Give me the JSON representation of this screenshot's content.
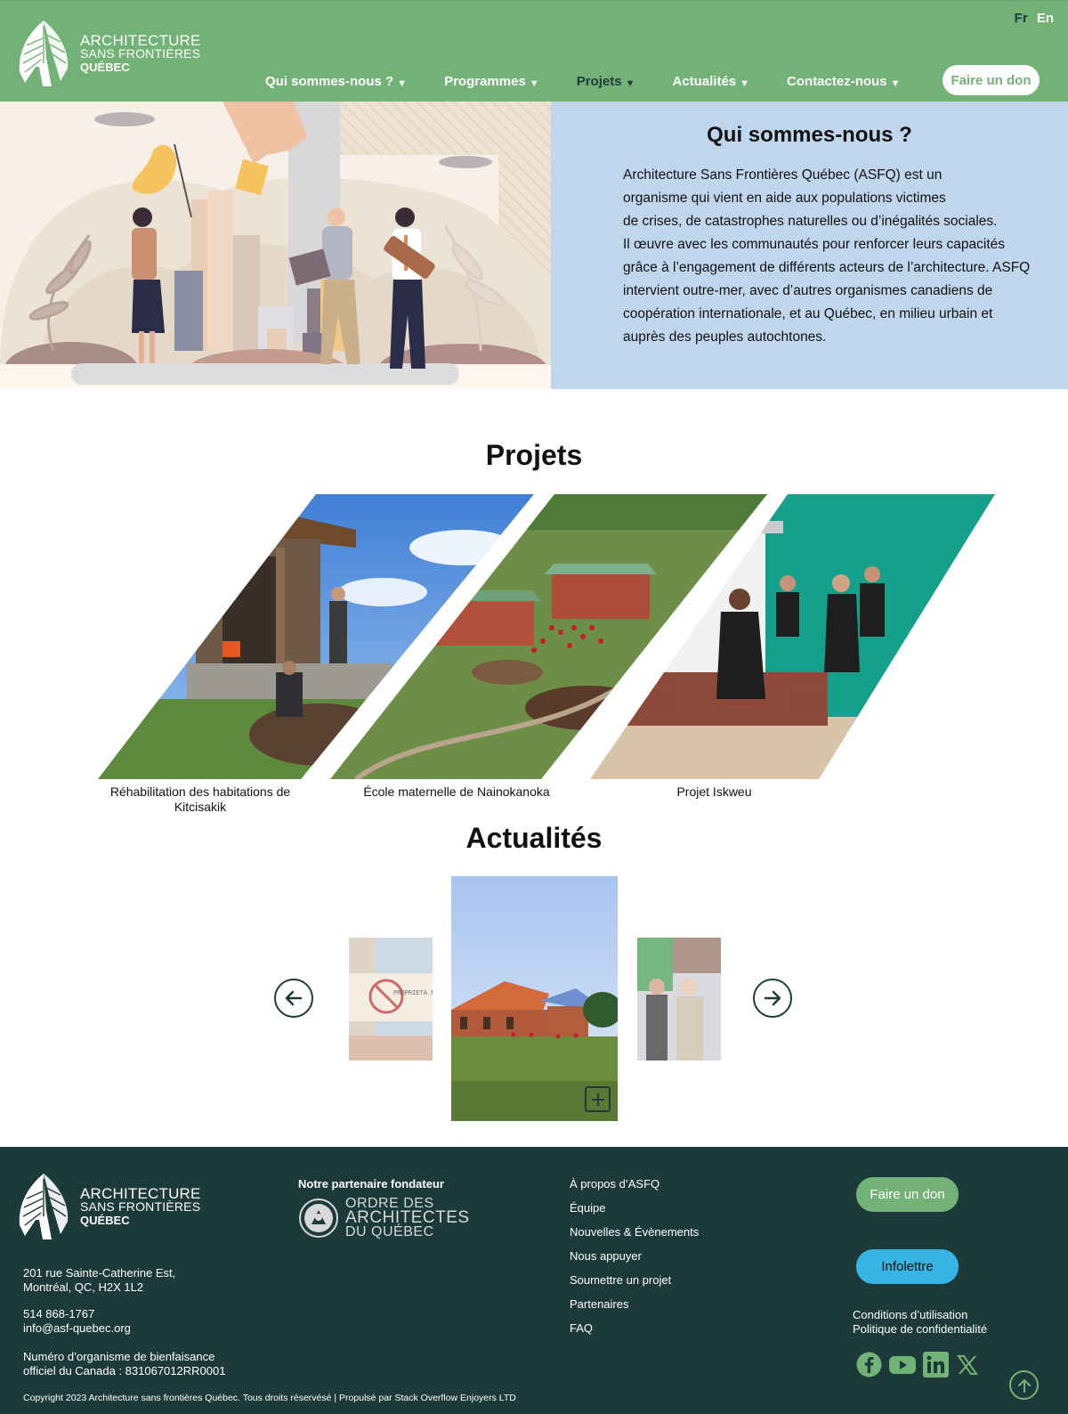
{
  "brand": {
    "line1": "ARCHITECTURE",
    "line2": "SANS FRONTIÈRES",
    "line3": "QUÉBEC",
    "green": "#72b276",
    "dark": "#1c3a39"
  },
  "lang": {
    "fr": "Fr",
    "en": "En",
    "active": "Fr"
  },
  "nav": {
    "items": [
      {
        "label": "Qui sommes-nous ?",
        "caret": "▼"
      },
      {
        "label": "Programmes",
        "caret": "▼"
      },
      {
        "label": "Projets",
        "caret": "▼",
        "active": true
      },
      {
        "label": "Actualités",
        "caret": "▼"
      },
      {
        "label": "Contactez-nous",
        "caret": "▼"
      }
    ],
    "donate": "Faire un don"
  },
  "hero": {
    "title": "Qui sommes-nous ?",
    "lines": [
      "Architecture Sans Frontières Québec (ASFQ) est un",
      "organisme qui vient en aide aux populations victimes",
      " de crises, de catastrophes naturelles ou d’inégalités sociales.",
      "Il œuvre avec les communautés pour renforcer leurs capacités",
      "grâce à l’engagement de différents acteurs de l’architecture. ASFQ",
      " intervient outre-mer, avec d’autres organismes canadiens de",
      " coopération internationale, et au Québec, en milieu urbain et",
      "auprès des peuples autochtones."
    ]
  },
  "projects": {
    "title": "Projets",
    "items": [
      {
        "caption_line1": "Réhabilitation des habitations de",
        "caption_line2": "Kitcisakik"
      },
      {
        "caption_line1": "École maternelle de Nainokanoka",
        "caption_line2": ""
      },
      {
        "caption_line1": "Projet Iskweu",
        "caption_line2": ""
      }
    ]
  },
  "news": {
    "title": "Actualités",
    "prev_icon": "arrow-left-icon",
    "next_icon": "arrow-right-icon",
    "expand_icon": "plus-icon",
    "sign_text": "PROPRIETA PRIVATA"
  },
  "footer": {
    "address_line1": "201 rue Sainte-Catherine Est,",
    "address_line2": "Montréal, QC, H2X 1L2",
    "phone": "514 868-1767",
    "email": "info@asf-quebec.org",
    "charity_line1": "Numéro d’organisme de bienfaisance",
    "charity_line2": "officiel du Canada : 831067012RR0001",
    "partner_label": "Notre partenaire fondateur",
    "partner_line1": "ORDRE DES",
    "partner_line2": "ARCHITECTES",
    "partner_line3": "DU QUÉBEC",
    "links": [
      "À propos d’ASFQ",
      "Équipe",
      "Nouvelles & Évènements",
      "Nous appuyer",
      "Soumettre un projet",
      "Partenaires",
      "FAQ"
    ],
    "donate": "Faire un don",
    "newsletter": "Infolettre",
    "terms": "Conditions d’utilisation",
    "privacy": "Politique de confidentialité",
    "social_icons": [
      "facebook-icon",
      "youtube-icon",
      "linkedin-icon",
      "x-icon"
    ],
    "copyright": "Copyright 2023 Architecture sans frontières Québec. Tous droits réservésé | Propulsé par Stack Overflow Enjoyers LTD",
    "newsletter_color": "#38b4e3"
  }
}
